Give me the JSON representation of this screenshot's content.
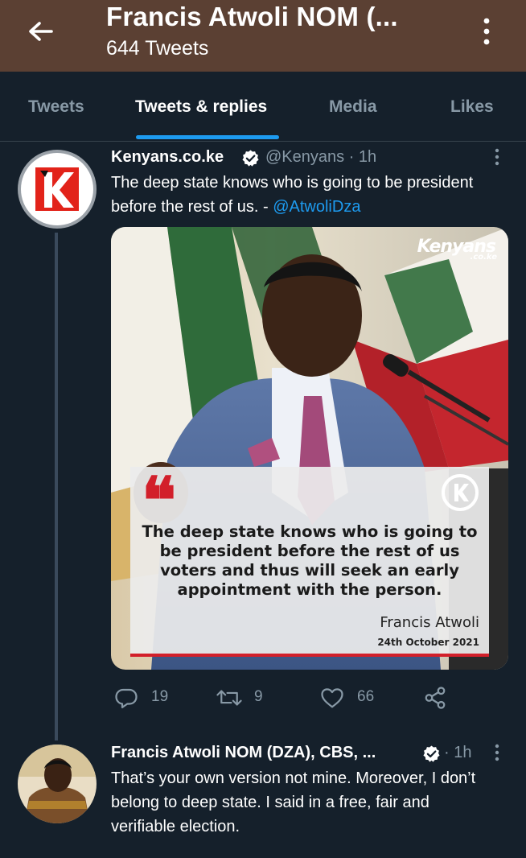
{
  "header": {
    "title": "Francis Atwoli NOM (...",
    "subtitle": "644 Tweets"
  },
  "tabs": [
    {
      "label": "Tweets",
      "active": false
    },
    {
      "label": "Tweets & replies",
      "active": true
    },
    {
      "label": "Media",
      "active": false
    },
    {
      "label": "Likes",
      "active": false
    }
  ],
  "tweets": [
    {
      "name": "Kenyans.co.ke",
      "verified": true,
      "handle_time": "@Kenyans · 1h",
      "text": "The deep state knows who is going to be president before the rest of us. -",
      "mention": "@AtwoliDza",
      "media": {
        "brand": "Kenyans",
        "brand_sub": ".co.ke",
        "quote_mark": "❝",
        "quote_text": "The deep state knows who is going to be president before the rest of us voters and thus will seek an early appointment with the person.",
        "quote_author": "Francis Atwoli",
        "quote_date": "24th October 2021"
      },
      "actions": {
        "replies": "19",
        "retweets": "9",
        "likes": "66"
      }
    },
    {
      "name": "Francis Atwoli NOM (DZA), CBS, ...",
      "verified": true,
      "handle_time": "· 1h",
      "text": "That’s your own version not mine. Moreover, I don’t belong to deep state. I said in a free, fair and verifiable election."
    }
  ],
  "colors": {
    "header_bg": "#5b4033",
    "page_bg": "#15202b",
    "accent": "#1d9bf0",
    "muted": "#8899a6",
    "kenyans_red": "#d21f2a"
  },
  "icons": [
    "back-arrow-icon",
    "more-vertical-icon",
    "verified-badge-icon",
    "reply-icon",
    "retweet-icon",
    "like-icon",
    "share-icon"
  ]
}
